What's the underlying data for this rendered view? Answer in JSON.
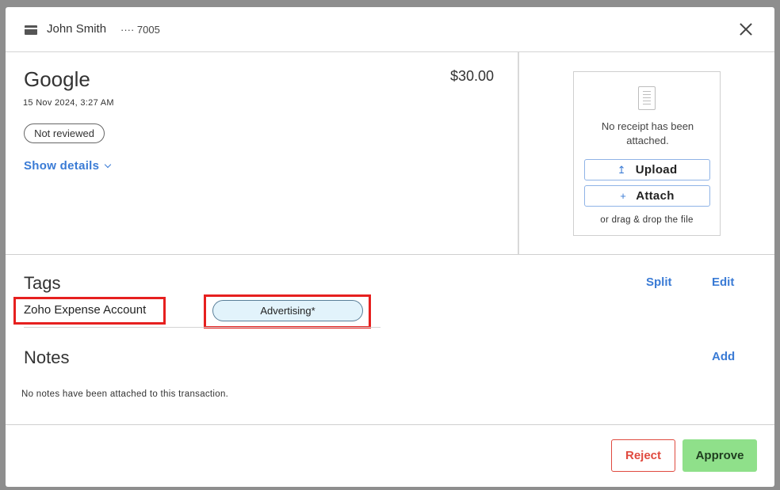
{
  "header": {
    "cardholder": "John Smith",
    "card_digits": "···· 7005"
  },
  "transaction": {
    "merchant": "Google",
    "amount": "$30.00",
    "datetime": "15 Nov 2024, 3:27 AM",
    "status": "Not reviewed",
    "show_details_label": "Show details"
  },
  "receipt": {
    "message": "No receipt has been attached.",
    "upload_label": "Upload",
    "upload_icon": "↥",
    "attach_label": "Attach",
    "attach_icon": "+",
    "drag_text": "or drag & drop the file"
  },
  "tags": {
    "title": "Tags",
    "split_label": "Split",
    "edit_label": "Edit",
    "items": [
      {
        "name": "Zoho Expense Account",
        "value": "Advertising*"
      }
    ],
    "highlight_color": "#e6201f"
  },
  "notes": {
    "title": "Notes",
    "add_label": "Add",
    "empty_text": "No notes have been attached to this transaction."
  },
  "footer": {
    "reject_label": "Reject",
    "approve_label": "Approve",
    "reject_color": "#e04a3f",
    "approve_color": "#8fe08a"
  }
}
